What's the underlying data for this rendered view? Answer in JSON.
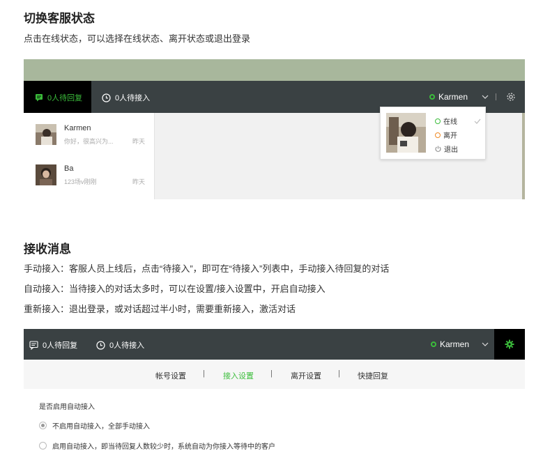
{
  "section1": {
    "title": "切换客服状态",
    "desc": "点击在线状态，可以选择在线状态、离开状态或退出登录"
  },
  "shot1": {
    "tabs": [
      {
        "label": "0人待回复",
        "active": true
      },
      {
        "label": "0人待接入",
        "active": false
      }
    ],
    "user_name": "Karmen",
    "chats": [
      {
        "name": "Karmen",
        "message": "你好，很高兴为...",
        "time": "昨天"
      },
      {
        "name": "Ba",
        "message": "123场v刚刚",
        "time": "昨天"
      }
    ],
    "status_menu": [
      {
        "label": "在线",
        "color": "#3bbd3b",
        "checked": true
      },
      {
        "label": "离开",
        "color": "#f08a24"
      },
      {
        "label": "退出",
        "color": "#888888"
      }
    ]
  },
  "section2": {
    "title": "接收消息",
    "lines": [
      "手动接入：客服人员上线后，点击“待接入”，即可在“待接入”列表中，手动接入待回复的对话",
      "自动接入：当待接入的对话太多时，可以在设置/接入设置中，开启自动接入",
      "重新接入：退出登录，或对话超过半小时，需要重新接入，激活对话"
    ]
  },
  "shot2": {
    "tabs": [
      {
        "label": "0人待回复"
      },
      {
        "label": "0人待接入"
      }
    ],
    "user_name": "Karmen",
    "subnav": [
      {
        "label": "帐号设置",
        "active": false
      },
      {
        "label": "接入设置",
        "active": true
      },
      {
        "label": "离开设置",
        "active": false
      },
      {
        "label": "快捷回复",
        "active": false
      }
    ],
    "separator": "|",
    "question": "是否启用自动接入",
    "options": [
      {
        "label": "不启用自动接入，全部手动接入",
        "selected": true
      },
      {
        "label": "启用自动接入，即当待回复人数较少时，系统自动为你接入等待中的客户",
        "selected": false
      }
    ]
  },
  "colors": {
    "accent_green": "#3bbd3b",
    "bar_dark": "#3a4143",
    "away_orange": "#f08a24"
  }
}
